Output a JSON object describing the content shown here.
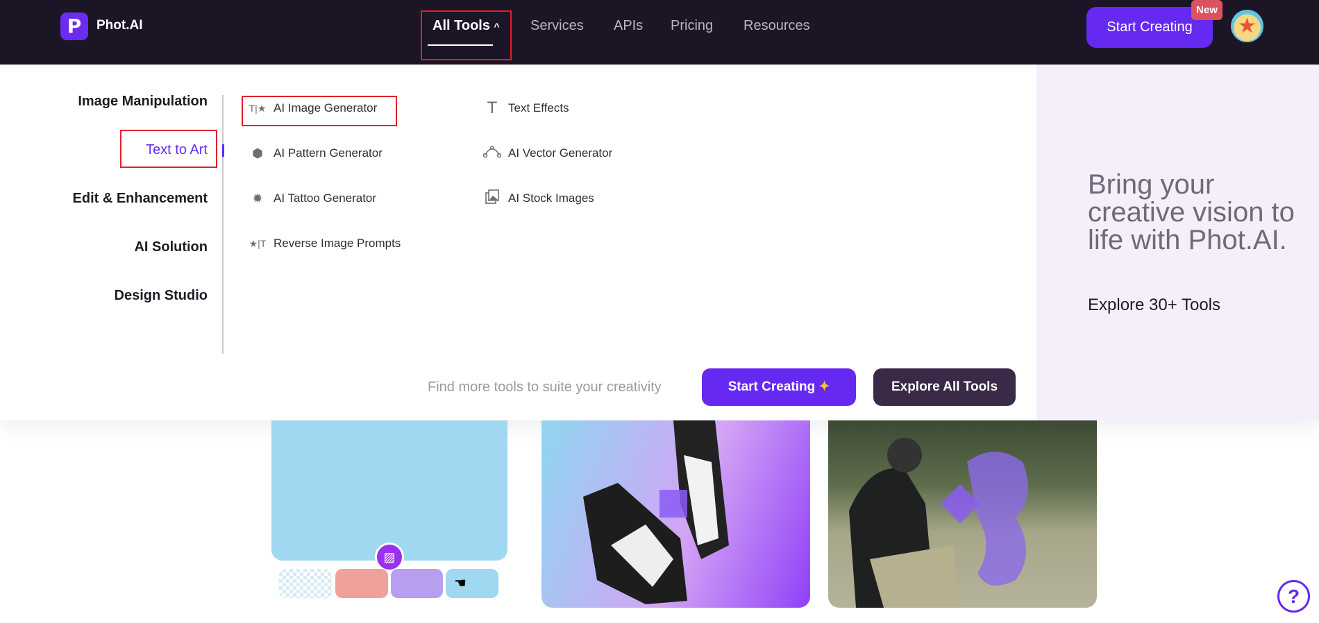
{
  "nav": {
    "brand": "Phot.AI",
    "logo_letter": "P",
    "items": [
      "All Tools",
      "Services",
      "APIs",
      "Pricing",
      "Resources"
    ],
    "all_tools_chevron": "^",
    "cta": "Start Creating",
    "new_badge": "New"
  },
  "dropdown": {
    "categories": [
      "Image Manipulation",
      "Text to Art",
      "Edit & Enhancement",
      "AI Solution",
      "Design Studio"
    ],
    "active_category": "Text to Art",
    "tools": [
      {
        "label": "AI Image Generator",
        "icon": "text-star-icon"
      },
      {
        "label": "AI Pattern Generator",
        "icon": "hexagons-icon"
      },
      {
        "label": "AI Tattoo Generator",
        "icon": "sun-burst-icon"
      },
      {
        "label": "Reverse Image Prompts",
        "icon": "star-text-icon"
      },
      {
        "label": "Text Effects",
        "icon": "text-t-icon"
      },
      {
        "label": "AI Vector Generator",
        "icon": "bezier-curve-icon"
      },
      {
        "label": "AI Stock Images",
        "icon": "image-stack-icon"
      }
    ],
    "footer_text": "Find more tools to suite your creativity",
    "start_creating": "Start Creating",
    "explore_all": "Explore All Tools",
    "tagline": "Bring your creative vision to life with Phot.AI.",
    "tagline_sub": "Explore 30+ Tools"
  },
  "help": "?",
  "colors": {
    "nav_bg": "#1b1526",
    "accent": "#6629f2",
    "badge": "#de5260",
    "panel_right": "#f4effb",
    "dark_button": "#3a2a48"
  }
}
